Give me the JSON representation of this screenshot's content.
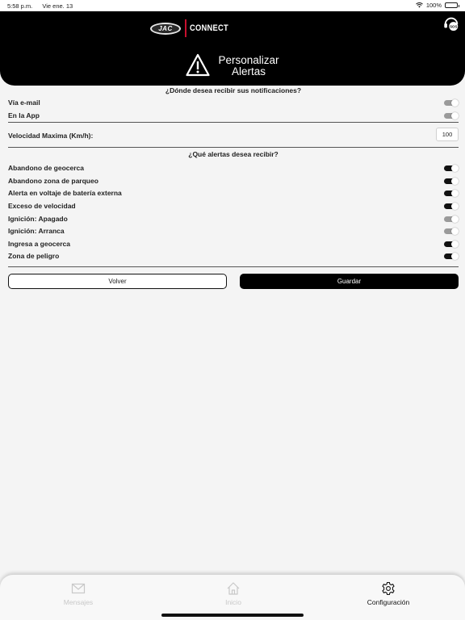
{
  "status_bar": {
    "time": "5:58 p.m.",
    "date": "Vie ene. 13",
    "battery": "100%"
  },
  "header": {
    "logo_mark": "JAC",
    "logo_text": "CONNECT",
    "title_line1": "Personalizar",
    "title_line2": "Alertas"
  },
  "notifications": {
    "heading": "¿Dónde desea recibir sus notificaciones?",
    "items": [
      {
        "label": "Vía e-mail",
        "enabled": false
      },
      {
        "label": "En la App",
        "enabled": false
      }
    ]
  },
  "speed": {
    "label": "Velocidad Maxima (Km/h):",
    "value": "100"
  },
  "alerts": {
    "heading": "¿Qué alertas desea recibir?",
    "items": [
      {
        "label": "Abandono de geocerca",
        "enabled": true
      },
      {
        "label": "Abandono zona de parqueo",
        "enabled": true
      },
      {
        "label": "Alerta en voltaje de batería externa",
        "enabled": true
      },
      {
        "label": "Exceso de velocidad",
        "enabled": true
      },
      {
        "label": "Ignición: Apagado",
        "enabled": false
      },
      {
        "label": "Ignición: Arranca",
        "enabled": false
      },
      {
        "label": "Ingresa a geocerca",
        "enabled": true
      },
      {
        "label": "Zona de peligro",
        "enabled": true
      }
    ]
  },
  "buttons": {
    "back": "Volver",
    "save": "Guardar"
  },
  "tabbar": {
    "items": [
      {
        "label": "Mensajes",
        "icon": "envelope-icon",
        "active": false
      },
      {
        "label": "Inicio",
        "icon": "home-icon",
        "active": false
      },
      {
        "label": "Configuración",
        "icon": "gear-icon",
        "active": true
      }
    ]
  },
  "colors": {
    "header_bg": "#000000",
    "toggle_on": "#111111",
    "toggle_off": "#9a9a9a",
    "logo_accent": "#c8102e"
  }
}
